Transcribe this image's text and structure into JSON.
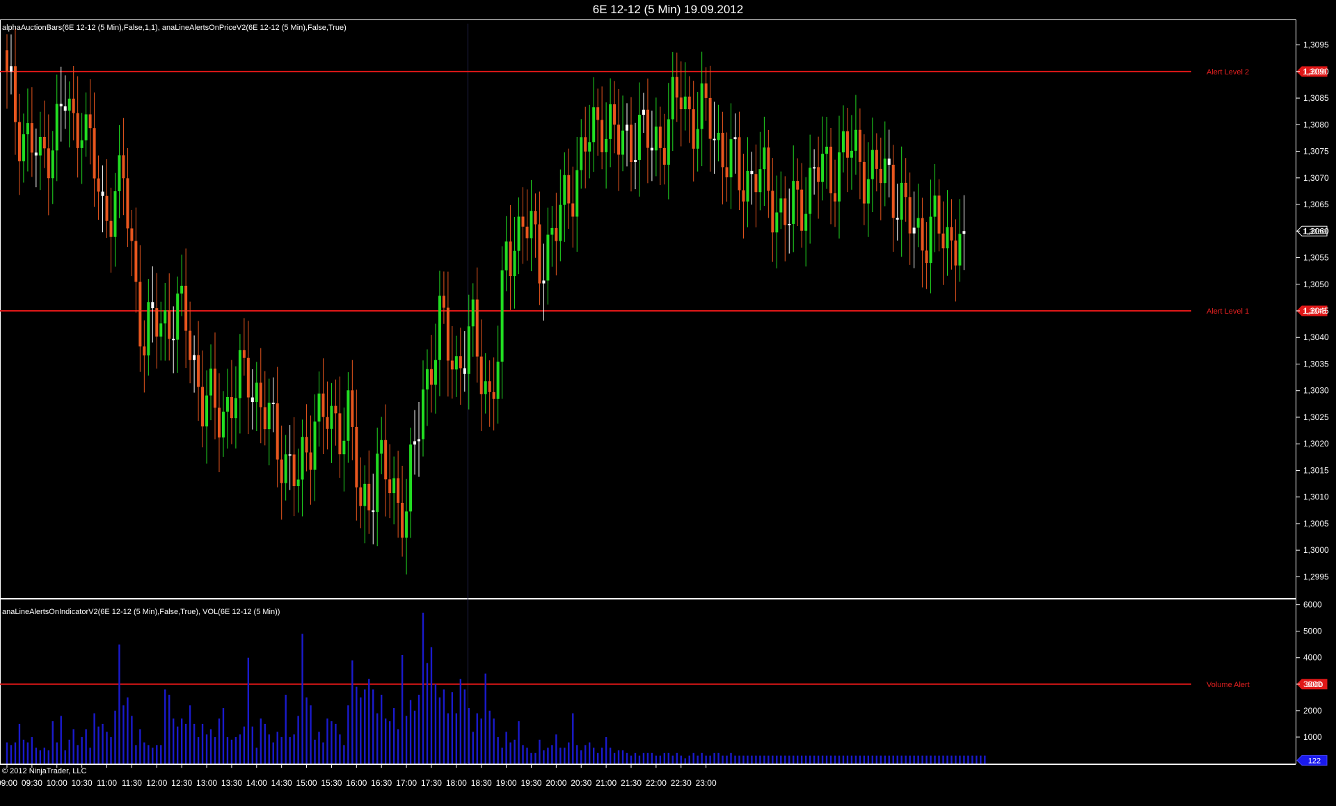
{
  "window": {
    "title": "6E 12-12 (5 Min)  19.09.2012"
  },
  "price_panel": {
    "indicator_label": "alphaAuctionBars(6E 12-12 (5 Min),False,1,1), anaLineAlertsOnPriceV2(6E 12-12 (5 Min),False,True)"
  },
  "volume_panel": {
    "indicator_label": "anaLineAlertsOnIndicatorV2(6E 12-12 (5 Min),False,True), VOL(6E 12-12 (5 Min))"
  },
  "footer": {
    "copyright": "© 2012 NinjaTrader, LLC"
  },
  "colors": {
    "up": "#22dd22",
    "down": "#e8561e",
    "doji": "#ffffff",
    "volume": "#1a1acc",
    "alert": "#e01818",
    "background": "#000000"
  },
  "chart_data": [
    {
      "type": "candlestick",
      "title": "6E 12-12 (5 Min)  19.09.2012",
      "ylim": [
        1.2991,
        1.3099
      ],
      "yticks": [
        "1,2995",
        "1,3000",
        "1,3005",
        "1,3010",
        "1,3015",
        "1,3020",
        "1,3025",
        "1,3030",
        "1,3035",
        "1,3040",
        "1,3045",
        "1,3050",
        "1,3055",
        "1,3060",
        "1,3065",
        "1,3070",
        "1,3075",
        "1,3080",
        "1,3085",
        "1,3090",
        "1,3095"
      ],
      "ytick_values": [
        1.2995,
        1.3,
        1.3005,
        1.301,
        1.3015,
        1.302,
        1.3025,
        1.303,
        1.3035,
        1.304,
        1.3045,
        1.305,
        1.3055,
        1.306,
        1.3065,
        1.307,
        1.3075,
        1.308,
        1.3085,
        1.309,
        1.3095
      ],
      "xticks": [
        "09:00",
        "09:30",
        "10:00",
        "10:30",
        "11:00",
        "11:30",
        "12:00",
        "12:30",
        "13:00",
        "13:30",
        "14:00",
        "14:30",
        "15:00",
        "15:30",
        "16:00",
        "16:30",
        "17:00",
        "17:30",
        "18:00",
        "18:30",
        "19:00",
        "19:30",
        "20:00",
        "20:30",
        "21:00",
        "21:30",
        "22:00",
        "22:30",
        "23:00"
      ],
      "alert_lines": [
        {
          "label": "Alert Level 2",
          "value": 1.309,
          "marker": "1,3090"
        },
        {
          "label": "Alert Level 1",
          "value": 1.3045,
          "marker": "1,3045"
        }
      ],
      "last_price_marker": "1,3060",
      "close_anchors": [
        [
          0,
          1.3087
        ],
        [
          3,
          1.308
        ],
        [
          6,
          1.3076
        ],
        [
          8,
          1.3072
        ],
        [
          10,
          1.3077
        ],
        [
          12,
          1.308
        ],
        [
          14,
          1.3084
        ],
        [
          16,
          1.3079
        ],
        [
          18,
          1.3083
        ],
        [
          20,
          1.3075
        ],
        [
          23,
          1.3063
        ],
        [
          25,
          1.3066
        ],
        [
          28,
          1.3069
        ],
        [
          30,
          1.3056
        ],
        [
          33,
          1.3039
        ],
        [
          36,
          1.3043
        ],
        [
          40,
          1.3044
        ],
        [
          43,
          1.3043
        ],
        [
          47,
          1.3028
        ],
        [
          50,
          1.3026
        ],
        [
          54,
          1.3028
        ],
        [
          58,
          1.3034
        ],
        [
          62,
          1.3025
        ],
        [
          66,
          1.3019
        ],
        [
          70,
          1.3012
        ],
        [
          74,
          1.3026
        ],
        [
          78,
          1.3023
        ],
        [
          82,
          1.3026
        ],
        [
          85,
          1.3007
        ],
        [
          89,
          1.3016
        ],
        [
          93,
          1.3011
        ],
        [
          96,
          1.3008
        ],
        [
          98,
          1.3018
        ],
        [
          100,
          1.303
        ],
        [
          104,
          1.3042
        ],
        [
          108,
          1.3035
        ],
        [
          112,
          1.304
        ],
        [
          116,
          1.3029
        ],
        [
          118,
          1.3035
        ],
        [
          120,
          1.3056
        ],
        [
          124,
          1.3062
        ],
        [
          128,
          1.3055
        ],
        [
          132,
          1.306
        ],
        [
          136,
          1.307
        ],
        [
          140,
          1.3077
        ],
        [
          143,
          1.3082
        ],
        [
          147,
          1.3076
        ],
        [
          151,
          1.3079
        ],
        [
          155,
          1.3076
        ],
        [
          159,
          1.308
        ],
        [
          162,
          1.3086
        ],
        [
          165,
          1.3081
        ],
        [
          169,
          1.3081
        ],
        [
          172,
          1.3075
        ],
        [
          176,
          1.307
        ],
        [
          180,
          1.3071
        ],
        [
          184,
          1.3066
        ],
        [
          188,
          1.3062
        ],
        [
          191,
          1.3066
        ],
        [
          194,
          1.3071
        ],
        [
          198,
          1.3071
        ],
        [
          201,
          1.3075
        ],
        [
          205,
          1.3074
        ],
        [
          208,
          1.307
        ],
        [
          212,
          1.3071
        ],
        [
          216,
          1.3062
        ],
        [
          219,
          1.306
        ],
        [
          223,
          1.306
        ],
        [
          227,
          1.3059
        ],
        [
          230,
          1.306
        ]
      ]
    },
    {
      "type": "bar",
      "title": "VOL(6E 12-12 (5 Min))",
      "ylim": [
        0,
        6200
      ],
      "yticks": [
        "1000",
        "2000",
        "3000",
        "4000",
        "5000",
        "6000"
      ],
      "ytick_values": [
        1000,
        2000,
        3000,
        4000,
        5000,
        6000
      ],
      "alert_line": {
        "label": "Volume Alert",
        "value": 3000,
        "marker": "3000"
      },
      "last_value_marker": "122",
      "values": [
        800,
        700,
        800,
        1500,
        900,
        800,
        1000,
        600,
        500,
        600,
        500,
        1600,
        800,
        1800,
        500,
        900,
        1300,
        700,
        1000,
        1300,
        600,
        1900,
        1400,
        1500,
        1200,
        1000,
        2000,
        4500,
        2200,
        2500,
        1800,
        700,
        1300,
        800,
        700,
        600,
        700,
        700,
        2800,
        2600,
        1700,
        1400,
        1700,
        1500,
        2200,
        1500,
        1000,
        1500,
        1100,
        1300,
        1000,
        1700,
        2100,
        1000,
        900,
        1000,
        1100,
        1400,
        4000,
        1400,
        600,
        1700,
        1500,
        1100,
        800,
        1200,
        1000,
        2600,
        1000,
        1100,
        1800,
        4900,
        2500,
        2200,
        900,
        1200,
        800,
        1700,
        1600,
        1500,
        1100,
        700,
        2200,
        3900,
        2900,
        2500,
        2800,
        3200,
        2800,
        1900,
        2600,
        1700,
        1600,
        2100,
        1300,
        4100,
        1800,
        2400,
        2000,
        2600,
        5700,
        3800,
        4400,
        3000,
        2500,
        2800,
        1900,
        2700,
        1900,
        3200,
        2800,
        2100,
        1200,
        1900,
        1700,
        3400,
        2000,
        1700,
        1000,
        600,
        1200,
        800,
        900,
        1600,
        700,
        600,
        400,
        400,
        900,
        500,
        600,
        700,
        1100,
        600,
        600,
        800,
        1900,
        700,
        500,
        700,
        800,
        600,
        400,
        600,
        1000,
        600,
        400,
        500,
        500,
        400,
        300,
        400,
        300,
        400,
        400,
        400,
        300,
        300,
        400,
        400,
        300,
        400,
        300,
        200,
        300,
        400,
        300,
        400,
        300,
        300,
        400,
        400,
        300,
        300,
        400,
        300,
        300,
        300,
        300,
        300,
        300,
        300,
        300,
        300,
        300,
        300,
        300,
        300,
        300,
        300,
        300,
        300,
        300,
        300,
        300,
        300,
        300,
        300,
        300,
        300,
        300,
        300,
        300,
        300,
        300,
        300,
        300,
        300,
        300,
        300,
        300,
        300,
        300,
        300,
        300,
        300,
        300,
        300,
        300,
        300,
        300,
        300,
        300,
        300,
        300,
        300,
        300,
        300,
        300,
        300,
        300,
        300,
        300,
        300,
        300,
        300
      ]
    }
  ]
}
